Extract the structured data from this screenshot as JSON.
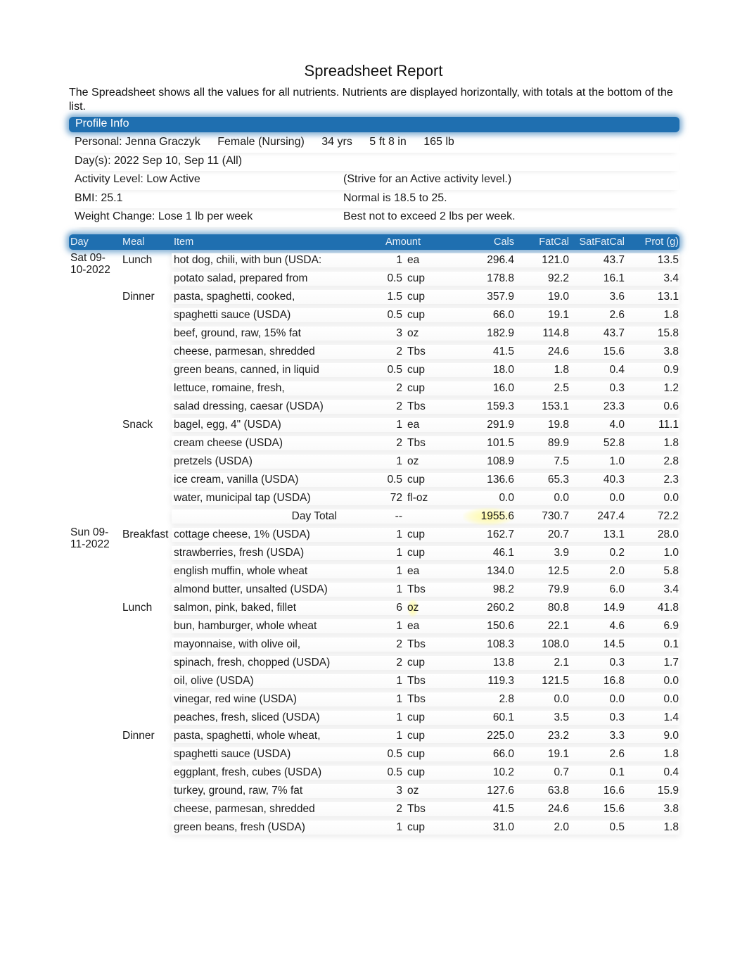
{
  "title": "Spreadsheet Report",
  "intro": "The Spreadsheet shows all the values for all nutrients. Nutrients are displayed horizontally, with totals at the bottom of the list.",
  "profile": {
    "section_label": "Profile Info",
    "personal_label": "Personal: Jenna Graczyk",
    "gender": "Female (Nursing)",
    "age": "34 yrs",
    "height": "5 ft 8 in",
    "weight": "165 lb",
    "days": "Day(s):  2022 Sep 10, Sep 11 (All)",
    "activity_level": "Activity Level: Low Active",
    "activity_note": "(Strive for an Active activity level.)",
    "bmi": "BMI: 25.1",
    "bmi_note": "Normal is 18.5 to 25.",
    "weight_change": "Weight Change: Lose 1 lb per week",
    "weight_change_note": "Best not to exceed 2 lbs per week."
  },
  "table": {
    "headers": {
      "day": "Day",
      "meal": "Meal",
      "item": "Item",
      "amount": "Amount",
      "cals": "Cals",
      "fatcal": "FatCal",
      "satfatcal": "SatFatCal",
      "prot": "Prot (g)"
    },
    "highlight_color": "#fff8a0",
    "header_color": "#1f6fb0",
    "rows": [
      {
        "day": "Sat 09-10-2022",
        "meal": "Lunch",
        "item": "hot dog, chili, with bun (USDA:",
        "qty": "1",
        "unit": "ea",
        "cals": "296.4",
        "fatcal": "121.0",
        "satfatcal": "43.7",
        "prot": "13.5"
      },
      {
        "day": "",
        "meal": "",
        "item": "potato salad, prepared from",
        "qty": "0.5",
        "unit": "cup",
        "cals": "178.8",
        "fatcal": "92.2",
        "satfatcal": "16.1",
        "prot": "3.4"
      },
      {
        "day": "",
        "meal": "Dinner",
        "item": "pasta, spaghetti, cooked,",
        "qty": "1.5",
        "unit": "cup",
        "cals": "357.9",
        "fatcal": "19.0",
        "satfatcal": "3.6",
        "prot": "13.1"
      },
      {
        "day": "",
        "meal": "",
        "item": "spaghetti sauce (USDA)",
        "qty": "0.5",
        "unit": "cup",
        "cals": "66.0",
        "fatcal": "19.1",
        "satfatcal": "2.6",
        "prot": "1.8"
      },
      {
        "day": "",
        "meal": "",
        "item": "beef, ground, raw, 15% fat",
        "qty": "3",
        "unit": "oz",
        "cals": "182.9",
        "fatcal": "114.8",
        "satfatcal": "43.7",
        "prot": "15.8"
      },
      {
        "day": "",
        "meal": "",
        "item": "cheese, parmesan, shredded",
        "qty": "2",
        "unit": "Tbs",
        "cals": "41.5",
        "fatcal": "24.6",
        "satfatcal": "15.6",
        "prot": "3.8"
      },
      {
        "day": "",
        "meal": "",
        "item": "green beans, canned, in liquid",
        "qty": "0.5",
        "unit": "cup",
        "cals": "18.0",
        "fatcal": "1.8",
        "satfatcal": "0.4",
        "prot": "0.9"
      },
      {
        "day": "",
        "meal": "",
        "item": "lettuce, romaine, fresh,",
        "qty": "2",
        "unit": "cup",
        "cals": "16.0",
        "fatcal": "2.5",
        "satfatcal": "0.3",
        "prot": "1.2"
      },
      {
        "day": "",
        "meal": "",
        "item": "salad dressing, caesar (USDA)",
        "qty": "2",
        "unit": "Tbs",
        "cals": "159.3",
        "fatcal": "153.1",
        "satfatcal": "23.3",
        "prot": "0.6"
      },
      {
        "day": "",
        "meal": "Snack",
        "item": "bagel, egg, 4\" (USDA)",
        "qty": "1",
        "unit": "ea",
        "cals": "291.9",
        "fatcal": "19.8",
        "satfatcal": "4.0",
        "prot": "11.1"
      },
      {
        "day": "",
        "meal": "",
        "item": "cream cheese (USDA)",
        "qty": "2",
        "unit": "Tbs",
        "cals": "101.5",
        "fatcal": "89.9",
        "satfatcal": "52.8",
        "prot": "1.8"
      },
      {
        "day": "",
        "meal": "",
        "item": "pretzels (USDA)",
        "qty": "1",
        "unit": "oz",
        "cals": "108.9",
        "fatcal": "7.5",
        "satfatcal": "1.0",
        "prot": "2.8"
      },
      {
        "day": "",
        "meal": "",
        "item": "ice cream, vanilla (USDA)",
        "qty": "0.5",
        "unit": "cup",
        "cals": "136.6",
        "fatcal": "65.3",
        "satfatcal": "40.3",
        "prot": "2.3"
      },
      {
        "day": "",
        "meal": "",
        "item": "water, municipal tap (USDA)",
        "qty": "72",
        "unit": "fl-oz",
        "cals": "0.0",
        "fatcal": "0.0",
        "satfatcal": "0.0",
        "prot": "0.0"
      },
      {
        "total": true,
        "label": "Day Total",
        "qty": "--",
        "cals": "1955.6",
        "fatcal": "730.7",
        "satfatcal": "247.4",
        "prot": "72.2",
        "highlight": "cals"
      },
      {
        "day": "Sun 09-11-2022",
        "meal": "Breakfast",
        "item": "cottage cheese, 1% (USDA)",
        "qty": "1",
        "unit": "cup",
        "cals": "162.7",
        "fatcal": "20.7",
        "satfatcal": "13.1",
        "prot": "28.0"
      },
      {
        "day": "",
        "meal": "",
        "item": "strawberries, fresh (USDA)",
        "qty": "1",
        "unit": "cup",
        "cals": "46.1",
        "fatcal": "3.9",
        "satfatcal": "0.2",
        "prot": "1.0"
      },
      {
        "day": "",
        "meal": "",
        "item": "english muffin, whole wheat",
        "qty": "1",
        "unit": "ea",
        "cals": "134.0",
        "fatcal": "12.5",
        "satfatcal": "2.0",
        "prot": "5.8"
      },
      {
        "day": "",
        "meal": "",
        "item": "almond butter, unsalted (USDA)",
        "qty": "1",
        "unit": "Tbs",
        "cals": "98.2",
        "fatcal": "79.9",
        "satfatcal": "6.0",
        "prot": "3.4"
      },
      {
        "day": "",
        "meal": "Lunch",
        "item": "salmon, pink, baked, fillet",
        "qty": "6",
        "unit": "oz",
        "cals": "260.2",
        "fatcal": "80.8",
        "satfatcal": "14.9",
        "prot": "41.8",
        "highlight": "unit"
      },
      {
        "day": "",
        "meal": "",
        "item": "bun, hamburger, whole wheat",
        "qty": "1",
        "unit": "ea",
        "cals": "150.6",
        "fatcal": "22.1",
        "satfatcal": "4.6",
        "prot": "6.9"
      },
      {
        "day": "",
        "meal": "",
        "item": "mayonnaise, with olive oil,",
        "qty": "2",
        "unit": "Tbs",
        "cals": "108.3",
        "fatcal": "108.0",
        "satfatcal": "14.5",
        "prot": "0.1"
      },
      {
        "day": "",
        "meal": "",
        "item": "spinach, fresh, chopped (USDA)",
        "qty": "2",
        "unit": "cup",
        "cals": "13.8",
        "fatcal": "2.1",
        "satfatcal": "0.3",
        "prot": "1.7"
      },
      {
        "day": "",
        "meal": "",
        "item": "oil, olive (USDA)",
        "qty": "1",
        "unit": "Tbs",
        "cals": "119.3",
        "fatcal": "121.5",
        "satfatcal": "16.8",
        "prot": "0.0"
      },
      {
        "day": "",
        "meal": "",
        "item": "vinegar, red wine (USDA)",
        "qty": "1",
        "unit": "Tbs",
        "cals": "2.8",
        "fatcal": "0.0",
        "satfatcal": "0.0",
        "prot": "0.0"
      },
      {
        "day": "",
        "meal": "",
        "item": "peaches, fresh, sliced (USDA)",
        "qty": "1",
        "unit": "cup",
        "cals": "60.1",
        "fatcal": "3.5",
        "satfatcal": "0.3",
        "prot": "1.4"
      },
      {
        "day": "",
        "meal": "Dinner",
        "item": "pasta, spaghetti, whole wheat,",
        "qty": "1",
        "unit": "cup",
        "cals": "225.0",
        "fatcal": "23.2",
        "satfatcal": "3.3",
        "prot": "9.0"
      },
      {
        "day": "",
        "meal": "",
        "item": "spaghetti sauce (USDA)",
        "qty": "0.5",
        "unit": "cup",
        "cals": "66.0",
        "fatcal": "19.1",
        "satfatcal": "2.6",
        "prot": "1.8"
      },
      {
        "day": "",
        "meal": "",
        "item": "eggplant, fresh, cubes (USDA)",
        "qty": "0.5",
        "unit": "cup",
        "cals": "10.2",
        "fatcal": "0.7",
        "satfatcal": "0.1",
        "prot": "0.4"
      },
      {
        "day": "",
        "meal": "",
        "item": "turkey, ground, raw, 7% fat",
        "qty": "3",
        "unit": "oz",
        "cals": "127.6",
        "fatcal": "63.8",
        "satfatcal": "16.6",
        "prot": "15.9"
      },
      {
        "day": "",
        "meal": "",
        "item": "cheese, parmesan, shredded",
        "qty": "2",
        "unit": "Tbs",
        "cals": "41.5",
        "fatcal": "24.6",
        "satfatcal": "15.6",
        "prot": "3.8"
      },
      {
        "day": "",
        "meal": "",
        "item": "green beans, fresh (USDA)",
        "qty": "1",
        "unit": "cup",
        "cals": "31.0",
        "fatcal": "2.0",
        "satfatcal": "0.5",
        "prot": "1.8"
      }
    ]
  }
}
